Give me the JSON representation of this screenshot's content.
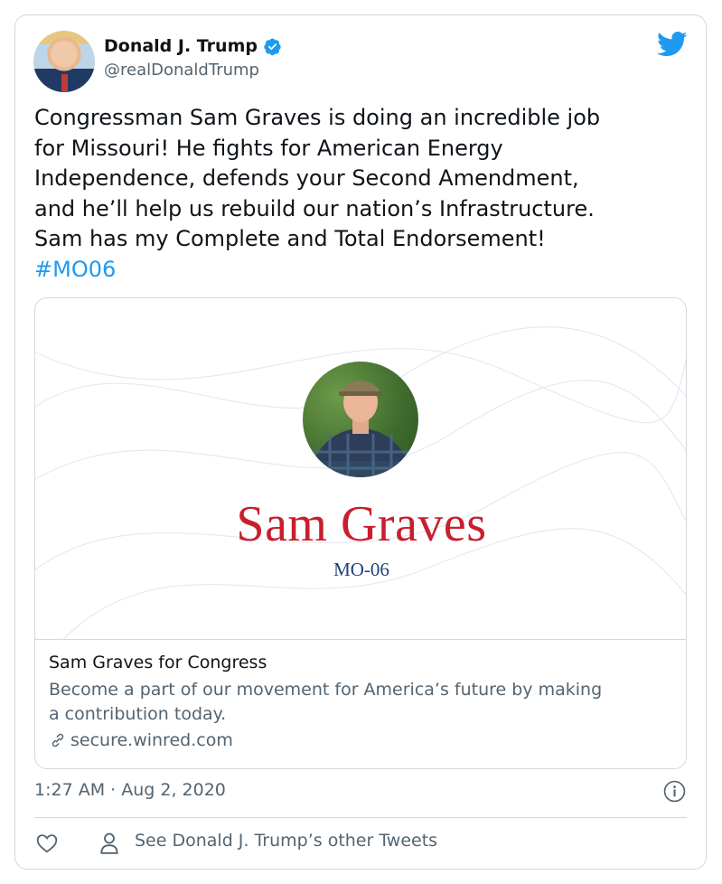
{
  "author": {
    "display_name": "Donald J. Trump",
    "handle": "@realDonaldTrump",
    "verified": true
  },
  "tweet": {
    "text": "Congressman Sam Graves is doing an incredible job\nfor Missouri! He fights for American Energy\nIndependence, defends your Second Amendment,\nand he’ll help us rebuild our nation’s Infrastructure.\nSam has my Complete and Total Endorsement!",
    "hashtag": "#MO06",
    "time": "1:27 AM · Aug 2, 2020"
  },
  "card": {
    "image_title": "Sam Graves",
    "image_subtitle": "MO-06",
    "title": "Sam Graves for Congress",
    "description": "Become a part of our movement for America’s future by making\na contribution today.",
    "link": "secure.winred.com"
  },
  "actions": {
    "other_tweets": "See Donald J. Trump’s other Tweets"
  },
  "colors": {
    "brand_blue": "#1d9bf0",
    "candidate_red": "#c81f2f",
    "district_blue": "#1f3f7a"
  },
  "icons": [
    "twitter-bird-icon",
    "verified-badge-icon",
    "link-icon",
    "info-icon",
    "heart-icon",
    "person-icon"
  ]
}
